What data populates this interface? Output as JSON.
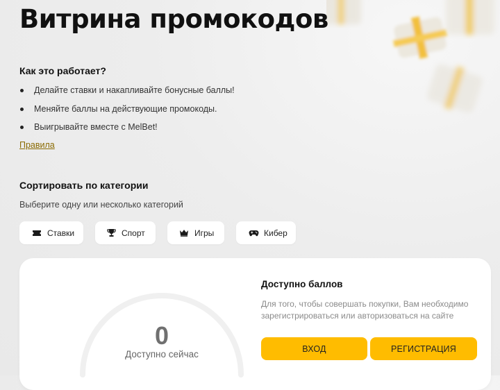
{
  "page": {
    "title": "Витрина промокодов"
  },
  "how_it_works": {
    "title": "Как это работает?",
    "items": [
      "Делайте ставки и накапливайте бонусные баллы!",
      "Меняйте баллы на действующие промокоды.",
      "Выигрывайте вместе с MelBet!"
    ],
    "rules_link": "Правила"
  },
  "sort": {
    "title": "Сортировать по категории",
    "subtitle": "Выберите одну или несколько категорий",
    "categories": [
      {
        "label": "Ставки",
        "icon": "ticket-icon"
      },
      {
        "label": "Спорт",
        "icon": "trophy-icon"
      },
      {
        "label": "Игры",
        "icon": "crown-icon"
      },
      {
        "label": "Кибер",
        "icon": "gamepad-icon"
      }
    ]
  },
  "points": {
    "value": "0",
    "gauge_label": "Доступно сейчас",
    "gauge_fill_fraction": 0,
    "title": "Доступно баллов",
    "description": "Для того, чтобы совершать покупки, Вам необходимо зарегистрироваться или авторизоваться на сайте",
    "login_label": "ВХОД",
    "register_label": "РЕГИСТРАЦИЯ"
  },
  "colors": {
    "accent": "#ffbc00",
    "link": "#8a6a00",
    "gauge_track": "#f0f0f0"
  }
}
